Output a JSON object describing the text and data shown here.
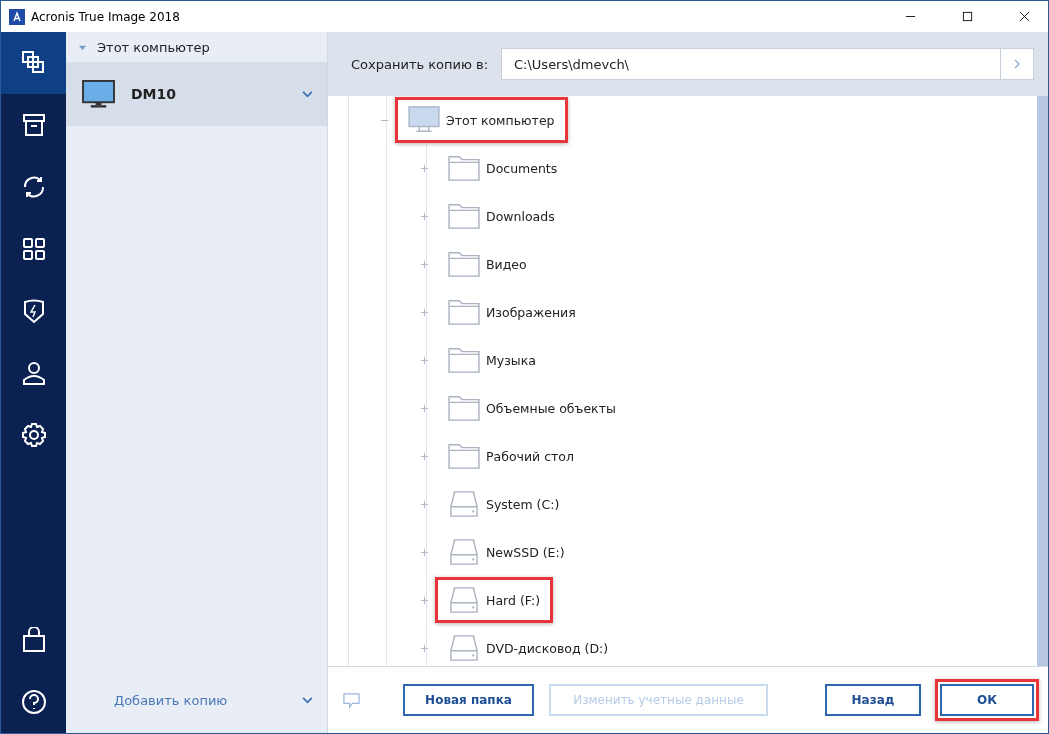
{
  "window": {
    "title": "Acronis True Image 2018"
  },
  "nav": [
    {
      "kind": "copies",
      "selected": true
    },
    {
      "kind": "archive",
      "selected": false
    },
    {
      "kind": "sync",
      "selected": false
    },
    {
      "kind": "tools",
      "selected": false
    },
    {
      "kind": "protection",
      "selected": false
    },
    {
      "kind": "account",
      "selected": false
    },
    {
      "kind": "settings",
      "selected": false
    }
  ],
  "nav_bottom": [
    {
      "kind": "store"
    },
    {
      "kind": "help"
    }
  ],
  "sources": {
    "heading": "Этот компьютер",
    "expanded": true,
    "items": [
      {
        "label": "DM10",
        "selected": true
      }
    ],
    "add_label": "Добавить копию"
  },
  "destination": {
    "label": "Сохранить копию в:",
    "value": "C:\\Users\\dmevch\\"
  },
  "tree": [
    {
      "label": "Этот компьютер",
      "kind": "computer",
      "expanded": true,
      "highlighted": true,
      "children": [
        {
          "label": "Documents",
          "kind": "folder",
          "expanded": false,
          "highlighted": false
        },
        {
          "label": "Downloads",
          "kind": "folder",
          "expanded": false,
          "highlighted": false
        },
        {
          "label": "Видео",
          "kind": "folder",
          "expanded": false,
          "highlighted": false
        },
        {
          "label": "Изображения",
          "kind": "folder",
          "expanded": false,
          "highlighted": false
        },
        {
          "label": "Музыка",
          "kind": "folder",
          "expanded": false,
          "highlighted": false
        },
        {
          "label": "Объемные объекты",
          "kind": "folder",
          "expanded": false,
          "highlighted": false
        },
        {
          "label": "Рабочий стол",
          "kind": "folder",
          "expanded": false,
          "highlighted": false
        },
        {
          "label": "System (C:)",
          "kind": "drive",
          "expanded": false,
          "highlighted": false
        },
        {
          "label": "NewSSD (E:)",
          "kind": "drive",
          "expanded": false,
          "highlighted": false
        },
        {
          "label": "Hard (F:)",
          "kind": "drive",
          "expanded": false,
          "highlighted": true
        },
        {
          "label": "DVD-дисковод (D:)",
          "kind": "drive",
          "expanded": false,
          "highlighted": false
        }
      ]
    }
  ],
  "buttons": [
    {
      "label": "Новая папка",
      "disabled": false,
      "highlighted": false
    },
    {
      "label": "Изменить учетные данные",
      "disabled": true,
      "highlighted": false
    },
    {
      "label": "Назад",
      "disabled": false,
      "highlighted": false
    },
    {
      "label": "ОК",
      "disabled": false,
      "highlighted": true
    }
  ]
}
